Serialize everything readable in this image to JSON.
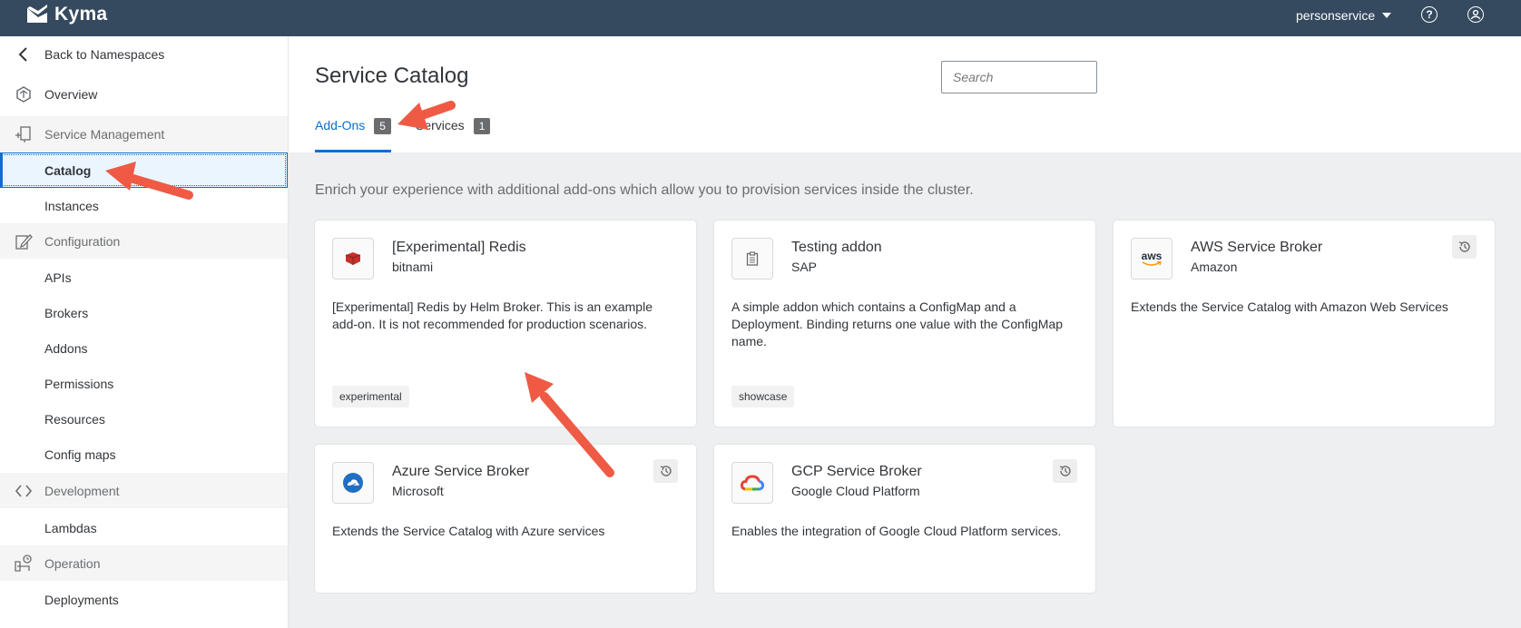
{
  "app": {
    "name": "Kyma"
  },
  "header": {
    "namespace": "personservice",
    "help_icon": "help-icon",
    "user_icon": "user-icon"
  },
  "sidebar": {
    "back_label": "Back to Namespaces",
    "overview_label": "Overview",
    "groups": {
      "service_management": "Service Management",
      "configuration": "Configuration",
      "development": "Development",
      "operation": "Operation"
    },
    "items": {
      "catalog": "Catalog",
      "instances": "Instances",
      "apis": "APIs",
      "brokers": "Brokers",
      "addons": "Addons",
      "permissions": "Permissions",
      "resources": "Resources",
      "config_maps": "Config maps",
      "lambdas": "Lambdas",
      "deployments": "Deployments"
    }
  },
  "main": {
    "title": "Service Catalog",
    "search_placeholder": "Search",
    "tabs": [
      {
        "label": "Add-Ons",
        "count": "5",
        "active": true
      },
      {
        "label": "Services",
        "count": "1",
        "active": false
      }
    ],
    "intro": "Enrich your experience with additional add-ons which allow you to provision services inside the cluster."
  },
  "cards": [
    {
      "title": "[Experimental] Redis",
      "provider": "bitnami",
      "description": "[Experimental] Redis by Helm Broker. This is an example add-on. It is not recommended for production scenarios.",
      "tag": "experimental",
      "icon": "redis-icon"
    },
    {
      "title": "Testing addon",
      "provider": "SAP",
      "description": "A simple addon which contains a ConfigMap and a Deployment. Binding returns one value with the ConfigMap name.",
      "tag": "showcase",
      "icon": "clipboard-icon"
    },
    {
      "title": "AWS Service Broker",
      "provider": "Amazon",
      "description": "Extends the Service Catalog with Amazon Web Services",
      "logo_text": "aws",
      "icon": "aws-icon"
    },
    {
      "title": "Azure Service Broker",
      "provider": "Microsoft",
      "description": "Extends the Service Catalog with Azure services",
      "icon": "azure-icon"
    },
    {
      "title": "GCP Service Broker",
      "provider": "Google Cloud Platform",
      "description": "Enables the integration of Google Cloud Platform services.",
      "icon": "gcp-icon"
    }
  ],
  "colors": {
    "topbar": "#354a5f",
    "accent": "#0a6ed1",
    "annotation_arrow": "#ef5a45",
    "content_bg": "#edeff0"
  }
}
